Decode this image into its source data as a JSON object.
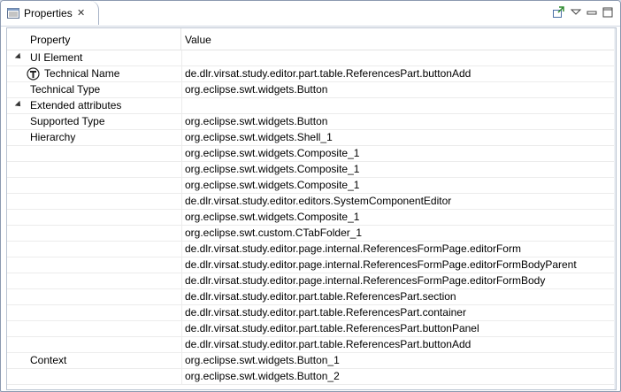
{
  "tab": {
    "title": "Properties",
    "close_glyph": "✕"
  },
  "view_actions": [
    "pin-icon",
    "view-menu-icon",
    "minimize-icon",
    "maximize-icon"
  ],
  "columns": {
    "property": "Property",
    "value": "Value"
  },
  "rows": [
    {
      "kind": "category",
      "property": "UI Element",
      "value": ""
    },
    {
      "kind": "item-icon",
      "property": "Technical Name",
      "value": "de.dlr.virsat.study.editor.part.table.ReferencesPart.buttonAdd"
    },
    {
      "kind": "item",
      "property": "Technical Type",
      "value": "org.eclipse.swt.widgets.Button"
    },
    {
      "kind": "category",
      "property": "Extended attributes",
      "value": ""
    },
    {
      "kind": "item",
      "property": "Supported Type",
      "value": "org.eclipse.swt.widgets.Button"
    },
    {
      "kind": "item",
      "property": "Hierarchy",
      "value": "org.eclipse.swt.widgets.Shell_1"
    },
    {
      "kind": "item",
      "property": "",
      "value": "org.eclipse.swt.widgets.Composite_1"
    },
    {
      "kind": "item",
      "property": "",
      "value": "org.eclipse.swt.widgets.Composite_1"
    },
    {
      "kind": "item",
      "property": "",
      "value": "org.eclipse.swt.widgets.Composite_1"
    },
    {
      "kind": "item",
      "property": "",
      "value": "de.dlr.virsat.study.editor.editors.SystemComponentEditor"
    },
    {
      "kind": "item",
      "property": "",
      "value": "org.eclipse.swt.widgets.Composite_1"
    },
    {
      "kind": "item",
      "property": "",
      "value": "org.eclipse.swt.custom.CTabFolder_1"
    },
    {
      "kind": "item",
      "property": "",
      "value": "de.dlr.virsat.study.editor.page.internal.ReferencesFormPage.editorForm"
    },
    {
      "kind": "item",
      "property": "",
      "value": "de.dlr.virsat.study.editor.page.internal.ReferencesFormPage.editorFormBodyParent"
    },
    {
      "kind": "item",
      "property": "",
      "value": "de.dlr.virsat.study.editor.page.internal.ReferencesFormPage.editorFormBody"
    },
    {
      "kind": "item",
      "property": "",
      "value": "de.dlr.virsat.study.editor.part.table.ReferencesPart.section"
    },
    {
      "kind": "item",
      "property": "",
      "value": "de.dlr.virsat.study.editor.part.table.ReferencesPart.container"
    },
    {
      "kind": "item",
      "property": "",
      "value": "de.dlr.virsat.study.editor.part.table.ReferencesPart.buttonPanel"
    },
    {
      "kind": "item",
      "property": "",
      "value": "de.dlr.virsat.study.editor.part.table.ReferencesPart.buttonAdd"
    },
    {
      "kind": "item",
      "property": "Context",
      "value": "org.eclipse.swt.widgets.Button_1"
    },
    {
      "kind": "item",
      "property": "",
      "value": "org.eclipse.swt.widgets.Button_2"
    }
  ],
  "colors": {
    "frame_border": "#8c99b0",
    "grid_line": "#ececec",
    "accent": "#2a6fb8"
  }
}
